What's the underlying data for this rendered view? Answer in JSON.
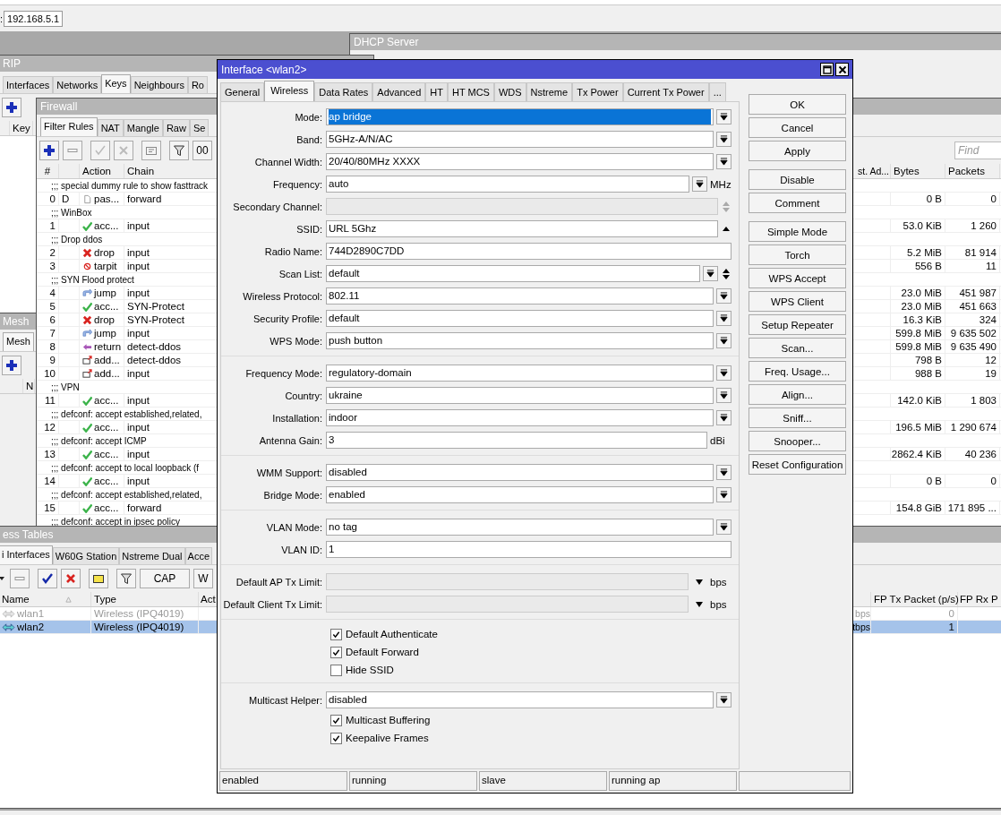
{
  "address": {
    "prefix": ":",
    "value": "192.168.5.1"
  },
  "dhcp_window": {
    "title": "DHCP Server"
  },
  "rip_window": {
    "title": "RIP",
    "tabs": [
      {
        "label": "Interfaces",
        "selected": false
      },
      {
        "label": "Networks",
        "selected": false
      },
      {
        "label": "Keys",
        "selected": true
      },
      {
        "label": "Neighbours",
        "selected": false
      },
      {
        "label": "Ro",
        "selected": false
      }
    ],
    "columns": [
      "Key"
    ]
  },
  "mesh_window": {
    "title": "Mesh",
    "tabs": [
      {
        "label": "Mesh",
        "selected": true
      }
    ],
    "columns": [
      "N"
    ]
  },
  "firewall_window": {
    "title": "Firewall",
    "tabs": [
      {
        "label": "Filter Rules",
        "selected": true
      },
      {
        "label": "NAT",
        "selected": false
      },
      {
        "label": "Mangle",
        "selected": false
      },
      {
        "label": "Raw",
        "selected": false
      },
      {
        "label": "Se",
        "selected": false
      }
    ],
    "counter_button": "00",
    "find_placeholder": "Find",
    "columns": {
      "num": "#",
      "action": "Action",
      "chain": "Chain",
      "column_5": "st. Ad...",
      "bytes": "Bytes",
      "packets": "Packets"
    },
    "rows": [
      {
        "kind": "comment",
        "text": ";;; special dummy rule to show fasttrack"
      },
      {
        "kind": "passthrough",
        "num": "0",
        "flag": "D",
        "action": "pas...",
        "chain": "forward",
        "bytes": "0 B",
        "packets": "0"
      },
      {
        "kind": "comment",
        "text": ";;; WinBox"
      },
      {
        "kind": "accept",
        "num": "1",
        "action": "acc...",
        "chain": "input",
        "bytes": "53.0 KiB",
        "packets": "1 260"
      },
      {
        "kind": "comment",
        "text": ";;; Drop ddos"
      },
      {
        "kind": "drop",
        "num": "2",
        "action": "drop",
        "chain": "input",
        "bytes": "5.2 MiB",
        "packets": "81 914"
      },
      {
        "kind": "tarpit",
        "num": "3",
        "action": "tarpit",
        "chain": "input",
        "bytes": "556 B",
        "packets": "11"
      },
      {
        "kind": "comment",
        "text": ";;; SYN Flood protect"
      },
      {
        "kind": "jump",
        "num": "4",
        "action": "jump",
        "chain": "input",
        "bytes": "23.0 MiB",
        "packets": "451 987"
      },
      {
        "kind": "accept",
        "num": "5",
        "action": "acc...",
        "chain": "SYN-Protect",
        "bytes": "23.0 MiB",
        "packets": "451 663"
      },
      {
        "kind": "drop",
        "num": "6",
        "action": "drop",
        "chain": "SYN-Protect",
        "bytes": "16.3 KiB",
        "packets": "324"
      },
      {
        "kind": "jump",
        "num": "7",
        "action": "jump",
        "chain": "input",
        "bytes": "599.8 MiB",
        "packets": "9 635 502"
      },
      {
        "kind": "return",
        "num": "8",
        "action": "return",
        "chain": "detect-ddos",
        "bytes": "599.8 MiB",
        "packets": "9 635 490"
      },
      {
        "kind": "add",
        "num": "9",
        "action": "add...",
        "chain": "detect-ddos",
        "bytes": "798 B",
        "packets": "12"
      },
      {
        "kind": "add",
        "num": "10",
        "action": "add...",
        "chain": "input",
        "bytes": "988 B",
        "packets": "19"
      },
      {
        "kind": "comment",
        "text": ";;; VPN"
      },
      {
        "kind": "accept",
        "num": "11",
        "action": "acc...",
        "chain": "input",
        "bytes": "142.0 KiB",
        "packets": "1 803"
      },
      {
        "kind": "comment",
        "text": ";;; defconf: accept established,related,"
      },
      {
        "kind": "accept",
        "num": "12",
        "action": "acc...",
        "chain": "input",
        "bytes": "196.5 MiB",
        "packets": "1 290 674"
      },
      {
        "kind": "comment",
        "text": ";;; defconf: accept ICMP"
      },
      {
        "kind": "accept",
        "num": "13",
        "action": "acc...",
        "chain": "input",
        "bytes": "2862.4 KiB",
        "packets": "40 236"
      },
      {
        "kind": "comment",
        "text": ";;; defconf: accept to local loopback (f"
      },
      {
        "kind": "accept",
        "num": "14",
        "action": "acc...",
        "chain": "input",
        "bytes": "0 B",
        "packets": "0"
      },
      {
        "kind": "comment",
        "text": ";;; defconf: accept established,related,"
      },
      {
        "kind": "accept",
        "num": "15",
        "action": "acc...",
        "chain": "forward",
        "bytes": "154.8 GiB",
        "packets": "171 895 ..."
      },
      {
        "kind": "comment",
        "text": ";;; defconf: accept in ipsec policy"
      }
    ]
  },
  "wireless_window": {
    "title": "ess Tables",
    "tabs": [
      {
        "label": "i Interfaces",
        "selected": true
      },
      {
        "label": "W60G Station",
        "selected": false
      },
      {
        "label": "Nstreme Dual",
        "selected": false
      },
      {
        "label": "Acce",
        "selected": false
      }
    ],
    "buttons": [
      "CAP",
      "W"
    ],
    "columns": {
      "name": "Name",
      "type": "Type",
      "column_3": "Act",
      "fp_tx": "FP Tx Packet (p/s)",
      "fp_rx": "FP Rx P"
    },
    "rows": [
      {
        "name": "wlan1",
        "type": "Wireless (IPQ4019)",
        "rate": "bps",
        "fp_tx": "0",
        "disabled": true,
        "selected": false
      },
      {
        "name": "wlan2",
        "type": "Wireless (IPQ4019)",
        "rate": "tbps",
        "fp_tx": "1",
        "disabled": false,
        "selected": true
      }
    ]
  },
  "dialog": {
    "title": "Interface <wlan2>",
    "tabs": [
      {
        "label": "General",
        "selected": false
      },
      {
        "label": "Wireless",
        "selected": true
      },
      {
        "label": "Data Rates",
        "selected": false
      },
      {
        "label": "Advanced",
        "selected": false
      },
      {
        "label": "HT",
        "selected": false
      },
      {
        "label": "HT MCS",
        "selected": false
      },
      {
        "label": "WDS",
        "selected": false
      },
      {
        "label": "Nstreme",
        "selected": false
      },
      {
        "label": "Tx Power",
        "selected": false
      },
      {
        "label": "Current Tx Power",
        "selected": false
      },
      {
        "label": "...",
        "selected": false
      }
    ],
    "sections": [
      [
        {
          "kind": "dropdown",
          "label": "Mode:",
          "value": "ap bridge",
          "highlighted": true
        },
        {
          "kind": "dropdown",
          "label": "Band:",
          "value": "5GHz-A/N/AC"
        },
        {
          "kind": "dropdown",
          "label": "Channel Width:",
          "value": "20/40/80MHz XXXX"
        },
        {
          "kind": "dropdown",
          "label": "Frequency:",
          "value": "auto",
          "unit": "MHz"
        },
        {
          "kind": "updown",
          "label": "Secondary Channel:",
          "disabled": true
        },
        {
          "kind": "collapse",
          "label": "SSID:",
          "value": "URL 5Ghz"
        },
        {
          "kind": "text",
          "label": "Radio Name:",
          "value": "744D2890C7DD"
        },
        {
          "kind": "dropdown_updown",
          "label": "Scan List:",
          "value": "default"
        },
        {
          "kind": "dropdown",
          "label": "Wireless Protocol:",
          "value": "802.11"
        },
        {
          "kind": "dropdown",
          "label": "Security Profile:",
          "value": "default"
        },
        {
          "kind": "dropdown",
          "label": "WPS Mode:",
          "value": "push button"
        }
      ],
      [
        {
          "kind": "dropdown",
          "label": "Frequency Mode:",
          "value": "regulatory-domain"
        },
        {
          "kind": "dropdown",
          "label": "Country:",
          "value": "ukraine"
        },
        {
          "kind": "dropdown",
          "label": "Installation:",
          "value": "indoor"
        },
        {
          "kind": "text",
          "label": "Antenna Gain:",
          "value": "3",
          "unit": "dBi"
        }
      ],
      [
        {
          "kind": "dropdown",
          "label": "WMM Support:",
          "value": "disabled"
        },
        {
          "kind": "dropdown",
          "label": "Bridge Mode:",
          "value": "enabled"
        }
      ],
      [
        {
          "kind": "dropdown",
          "label": "VLAN Mode:",
          "value": "no tag"
        },
        {
          "kind": "text",
          "label": "VLAN ID:",
          "value": "1"
        }
      ],
      [
        {
          "kind": "arrow",
          "label": "Default AP Tx Limit:",
          "unit": "bps",
          "disabled": true
        },
        {
          "kind": "arrow",
          "label": "Default Client Tx Limit:",
          "unit": "bps",
          "disabled": true
        }
      ],
      [
        {
          "kind": "check",
          "label": "Default Authenticate",
          "checked": true
        },
        {
          "kind": "check",
          "label": "Default Forward",
          "checked": true
        },
        {
          "kind": "check",
          "label": "Hide SSID",
          "checked": false
        }
      ],
      [
        {
          "kind": "dropdown",
          "label": "Multicast Helper:",
          "value": "disabled"
        },
        {
          "kind": "check",
          "label": "Multicast Buffering",
          "checked": true
        },
        {
          "kind": "check",
          "label": "Keepalive Frames",
          "checked": true
        }
      ]
    ],
    "button_groups": [
      [
        "OK",
        "Cancel",
        "Apply"
      ],
      [
        "Disable",
        "Comment"
      ],
      [
        "Simple Mode",
        "Torch",
        "WPS Accept",
        "WPS Client",
        "Setup Repeater",
        "Scan...",
        "Freq. Usage...",
        "Align...",
        "Sniff...",
        "Snooper...",
        "Reset Configuration"
      ]
    ],
    "status": [
      "enabled",
      "running",
      "slave",
      "running ap"
    ]
  }
}
